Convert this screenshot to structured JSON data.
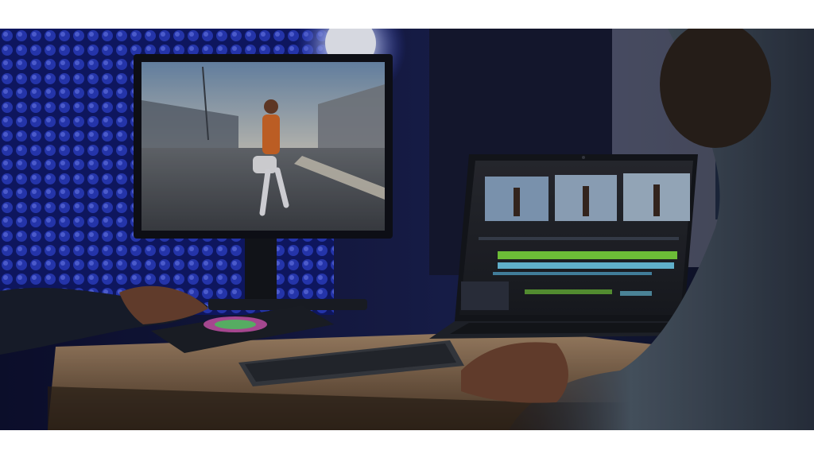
{
  "scene": {
    "background_color": "#ffffff",
    "accent_blue": "#2a3ec8",
    "wall_dark": "#121626",
    "desk_wood": "#8a6a4e",
    "skin": "#6e4431",
    "sky": "#9bb6d2",
    "timeline_green": "#7bd63f",
    "timeline_cyan": "#6ec8e6"
  },
  "icons": {
    "studio_light": "studio-light-icon",
    "camera": "webcam-icon"
  }
}
